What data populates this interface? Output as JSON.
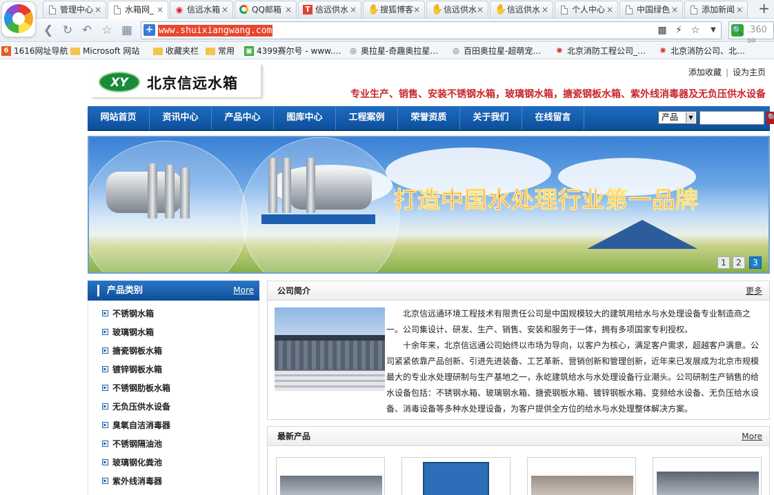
{
  "browser": {
    "tabs": [
      {
        "label": "管理中心",
        "icon": "doc"
      },
      {
        "label": "水箱网_",
        "icon": "doc"
      },
      {
        "label": "信远水箱",
        "icon": "weibo"
      },
      {
        "label": "QQ邮箱",
        "icon": "qq"
      },
      {
        "label": "信远供水",
        "icon": "tian"
      },
      {
        "label": "搜狐博客",
        "icon": "hand"
      },
      {
        "label": "信远供水",
        "icon": "hand"
      },
      {
        "label": "信远供水",
        "icon": "hand"
      },
      {
        "label": "个人中心",
        "icon": "doc"
      },
      {
        "label": "中国绿色",
        "icon": "doc"
      },
      {
        "label": "添加新闻",
        "icon": "doc"
      }
    ],
    "url": "www.shuixiangwang.com",
    "search_placeholder": ".360搜",
    "bookmarks": [
      {
        "label": "1616网址导航",
        "icon": "num"
      },
      {
        "label": "Microsoft 网站",
        "icon": "folder"
      },
      {
        "label": "收藏夹栏",
        "icon": "folder"
      },
      {
        "label": "常用",
        "icon": "folder"
      },
      {
        "label": "4399赛尔号 - www.…",
        "icon": "green"
      },
      {
        "label": "奥拉星-奇趣奥拉星…",
        "icon": "eye"
      },
      {
        "label": "百田奥拉星-超萌宠…",
        "icon": "eye"
      },
      {
        "label": "北京消防工程公司_…",
        "icon": "fire"
      },
      {
        "label": "北京消防公司、北…",
        "icon": "fire"
      }
    ]
  },
  "site": {
    "logo_badge": "XY",
    "logo_title": "北京信远水箱",
    "top_links": {
      "favorite": "添加收藏",
      "separator": "|",
      "homepage": "设为主页"
    },
    "slogan": "专业生产、销售、安装不锈钢水箱，玻璃钢水箱，搪瓷钢板水箱、紫外线消毒器及无负压供水设备",
    "nav": [
      "网站首页",
      "资讯中心",
      "产品中心",
      "图库中心",
      "工程案例",
      "荣誉资质",
      "关于我们",
      "在线留言"
    ],
    "search_select": "产品",
    "banner": {
      "slogan": "打造中国水处理行业第一品牌",
      "pages": [
        "1",
        "2",
        "3"
      ],
      "active_page": 3
    },
    "category": {
      "title": "产品类别",
      "more": "More",
      "items": [
        "不锈钢水箱",
        "玻璃钢水箱",
        "搪瓷钢板水箱",
        "镀锌钢板水箱",
        "不锈钢肋板水箱",
        "无负压供水设备",
        "臭氧自洁消毒器",
        "不锈钢隔油池",
        "玻璃钢化粪池",
        "紫外线消毒器"
      ]
    },
    "intro": {
      "title": "公司简介",
      "more": "更多",
      "p1": "北京信远通环境工程技术有限责任公司是中国规模较大的建筑用给水与水处理设备专业制造商之一。公司集设计、研发、生产、销售、安装和服务于一体，拥有多项国家专利授权。",
      "p2": "十余年来，北京信远通公司始终以市场为导向，以客户为核心，满足客户需求，超越客户满意。公司紧紧依靠产品创新、引进先进装备、工艺革新、营销创新和管理创新，近年来已发展成为北京市规模最大的专业水处理研制与生产基地之一，永屹建筑给水与水处理设备行业潮头。公司研制生产销售的给水设备包括：不锈钢水箱、玻璃钢水箱、搪瓷钢板水箱、镀锌钢板水箱、变频给水设备、无负压给水设备、消毒设备等多种水处理设备，为客户提供全方位的给水与水处理整体解决方案。"
    },
    "products": {
      "title": "最新产品",
      "more": "More"
    }
  }
}
